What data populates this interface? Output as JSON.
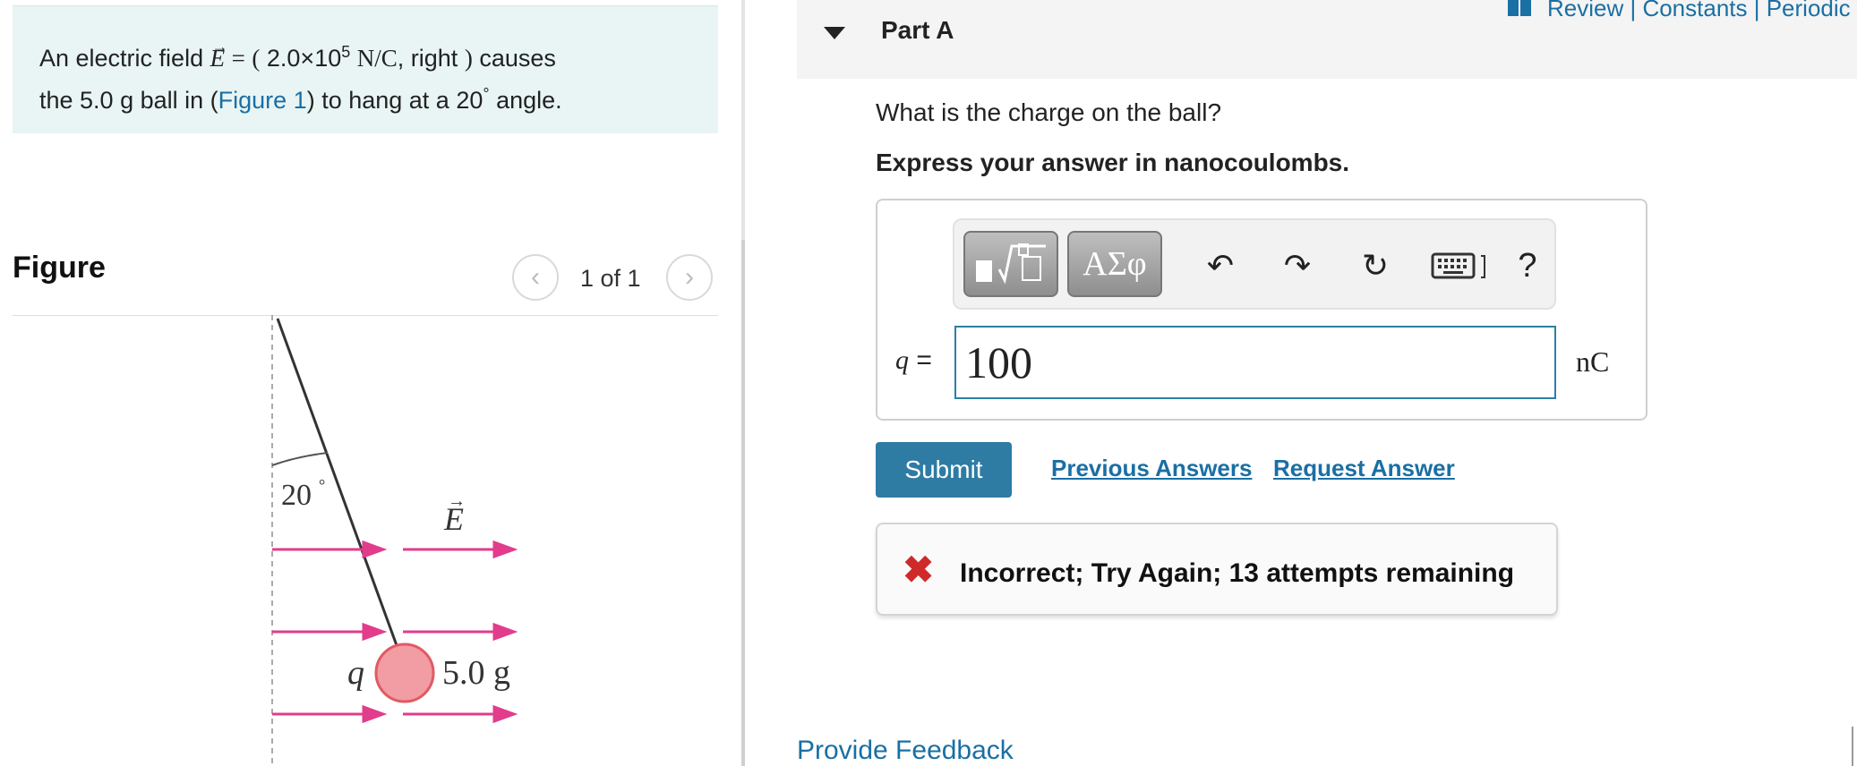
{
  "problem": {
    "text_intro": "An electric field",
    "field_symbol": "E",
    "field_equals": "=",
    "field_open": "(",
    "field_magnitude": "2.0×10",
    "field_exponent": "5",
    "field_units": "N/C",
    "field_direction": ", right",
    "field_close": ")",
    "text_causes": "causes",
    "text_line2_start": "the 5.0 g ball in (",
    "figure_link": "Figure 1",
    "text_line2_end": ") to hang at a 20",
    "degree": "°",
    "text_angle": " angle."
  },
  "figure": {
    "heading": "Figure",
    "counter": "1 of 1",
    "prev_glyph": "‹",
    "next_glyph": "›",
    "angle_label": "20",
    "angle_degree": "°",
    "field_label": "E",
    "charge_label": "q",
    "mass_label": "5.0 g"
  },
  "part": {
    "title": "Part A",
    "top_links": "Review | Constants | Periodic Table",
    "question": "What is the charge on the ball?",
    "instruction": "Express your answer in nanocoulombs."
  },
  "answer": {
    "variable": "q",
    "equals": "=",
    "value": "100",
    "unit": "nC"
  },
  "toolbar": {
    "symbols_label": "ΑΣφ",
    "undo_glyph": "↶",
    "redo_glyph": "↷",
    "reset_glyph": "↻",
    "help_label": "?"
  },
  "actions": {
    "submit_label": "Submit",
    "previous_answers_label": "Previous Answers",
    "request_answer_label": "Request Answer"
  },
  "feedback": {
    "icon": "✖",
    "message": "Incorrect; Try Again; 13 attempts remaining"
  },
  "footer": {
    "provide_feedback_label": "Provide Feedback"
  },
  "colors": {
    "link": "#1a6fa4",
    "submit": "#2e7ba4",
    "problem_bg": "#e8f5f4",
    "error": "#cf2a2a",
    "field_arrow": "#e23c8c",
    "ball_fill": "#f29ca3"
  }
}
